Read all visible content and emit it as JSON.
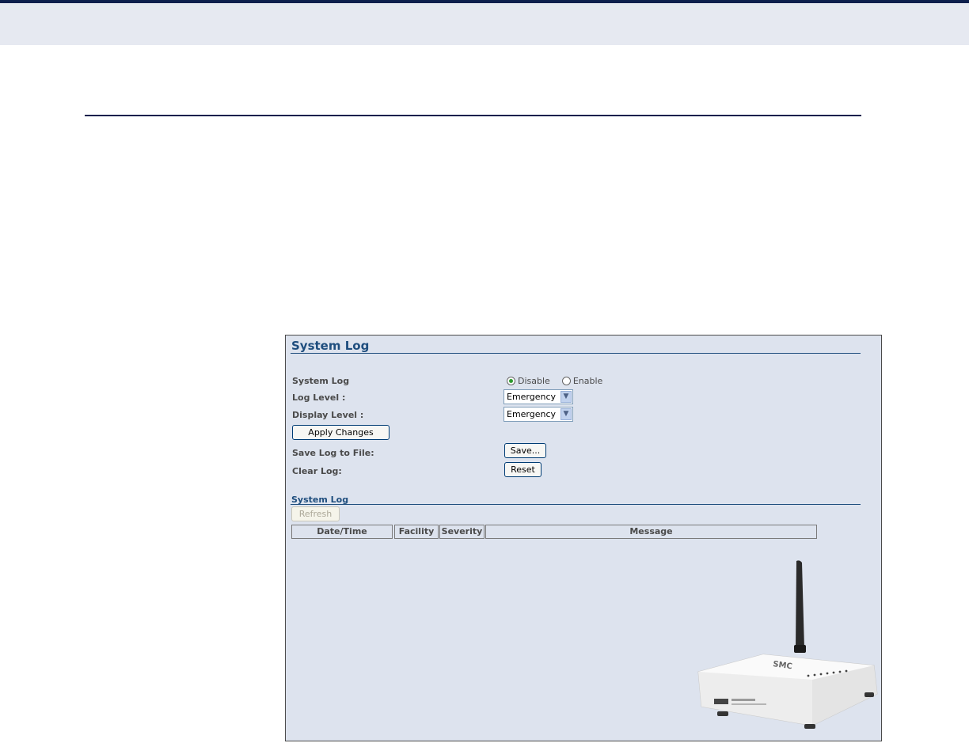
{
  "panel": {
    "title": "System Log",
    "system_log_label": "System Log",
    "radio_disable": "Disable",
    "radio_enable": "Enable",
    "radio_selected": "Disable",
    "log_level_label": "Log Level :",
    "log_level_value": "Emergency",
    "display_level_label": "Display Level :",
    "display_level_value": "Emergency",
    "apply_button": "Apply Changes",
    "save_log_label": "Save Log to File:",
    "save_button": "Save...",
    "clear_log_label": "Clear Log:",
    "reset_button": "Reset",
    "log_section_title": "System Log",
    "refresh_button": "Refresh",
    "table_headers": [
      "Date/Time",
      "Facility",
      "Severity",
      "Message"
    ],
    "device_label": "SMC"
  },
  "colors": {
    "header_band": "#e6e9f1",
    "rule": "#0d1f4d",
    "panel_bg": "#dde3ee",
    "title": "#1f4e7e"
  },
  "icons": {
    "dropdown_arrow": "chevron-down-icon",
    "device_image": "router-icon"
  }
}
